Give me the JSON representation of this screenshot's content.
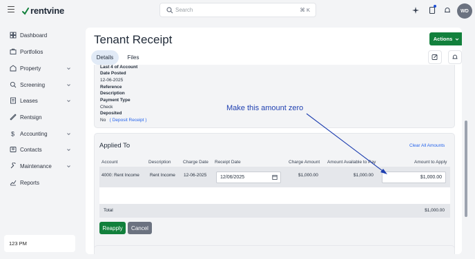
{
  "app": {
    "logo_text": "rentvine"
  },
  "search": {
    "placeholder": "Search",
    "shortcut": "⌘ K"
  },
  "user": {
    "initials": "WD"
  },
  "sidebar": {
    "items": [
      {
        "label": "Dashboard",
        "icon": "dashboard-icon",
        "has_chevron": false
      },
      {
        "label": "Portfolios",
        "icon": "portfolio-icon",
        "has_chevron": false
      },
      {
        "label": "Property",
        "icon": "property-icon",
        "has_chevron": true
      },
      {
        "label": "Screening",
        "icon": "screening-icon",
        "has_chevron": true
      },
      {
        "label": "Leases",
        "icon": "leases-icon",
        "has_chevron": true
      },
      {
        "label": "Rentsign",
        "icon": "rentsign-icon",
        "has_chevron": false
      },
      {
        "label": "Accounting",
        "icon": "dollar-icon",
        "has_chevron": true
      },
      {
        "label": "Contacts",
        "icon": "contacts-icon",
        "has_chevron": true
      },
      {
        "label": "Maintenance",
        "icon": "wrench-icon",
        "has_chevron": true
      },
      {
        "label": "Reports",
        "icon": "chart-icon",
        "has_chevron": false
      }
    ],
    "time": "123 PM"
  },
  "page": {
    "title": "Tenant Receipt",
    "actions_label": "Actions",
    "tabs": [
      {
        "label": "Details",
        "active": true
      },
      {
        "label": "Files",
        "active": false
      }
    ]
  },
  "details": {
    "last4_label": "Last 4 of Account",
    "date_posted_label": "Date Posted",
    "date_posted_value": "12-06-2025",
    "reference_label": "Reference",
    "description_label": "Description",
    "payment_type_label": "Payment Type",
    "payment_type_value": "Check",
    "deposited_label": "Deposited",
    "deposited_value": "No",
    "deposit_link": "( Deposit Receipt )"
  },
  "applied": {
    "title": "Applied To",
    "clear_all": "Clear All Amounts",
    "columns": [
      "Account",
      "Description",
      "Charge Date",
      "Receipt Date",
      "Charge Amount",
      "Amount Available to Pay",
      "Amount to Apply"
    ],
    "row": {
      "account": "4000: Rent Income",
      "description": "Rent Income",
      "charge_date": "12-06-2025",
      "receipt_date": "12/06/2025",
      "charge_amount": "$1,000.00",
      "available": "$1,000.00",
      "amount_to_apply": "$1,000.00"
    },
    "total_label": "Total",
    "total_value": "$1,000.00",
    "reapply_label": "Reapply",
    "cancel_label": "Cancel"
  },
  "annotation": {
    "text": "Make this amount zero",
    "color": "#1e3fb0"
  },
  "colors": {
    "primary_green": "#12803c",
    "link_blue": "#2563eb",
    "cancel_gray": "#6b7280"
  }
}
